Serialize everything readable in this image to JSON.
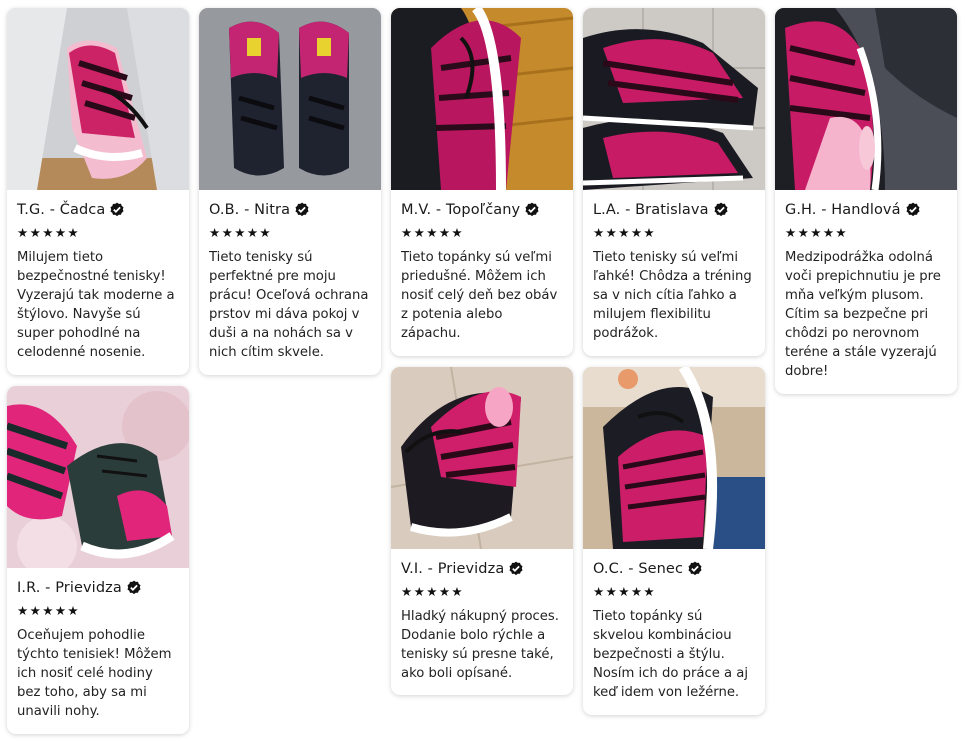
{
  "stars": "★★★★★",
  "reviews": [
    {
      "name": "T.G. - Čadca",
      "lines": [
        "Milujem tieto",
        "bezpečnostné tenisky!",
        "Vyzerajú tak moderne a",
        "štýlovo. Navyše sú",
        "super pohodlné na",
        "celodenné nosenie."
      ]
    },
    {
      "name": "I.R. - Prievidza",
      "lines": [
        "Oceňujem pohodlie",
        "týchto tenisiek! Môžem",
        "ich nosiť celé hodiny",
        "bez toho, aby sa mi",
        "unavili nohy."
      ]
    },
    {
      "name": "O.B. - Nitra",
      "lines": [
        "Tieto tenisky sú",
        "perfektné pre moju",
        "prácu! Oceľová ochrana",
        "prstov mi dáva pokoj v",
        "duši a na nohách sa v",
        "nich cítim skvele."
      ]
    },
    {
      "name": "M.V. - Topoľčany",
      "lines": [
        "Tieto topánky sú veľmi",
        "priedušné. Môžem ich",
        "nosiť celý deň bez obáv",
        "z potenia alebo",
        "zápachu."
      ]
    },
    {
      "name": "V.I. - Prievidza",
      "lines": [
        "Hladký nákupný proces.",
        "Dodanie bolo rýchle a",
        "tenisky sú presne také,",
        "ako boli opísané."
      ]
    },
    {
      "name": "L.A. - Bratislava",
      "lines": [
        "Tieto tenisky sú veľmi",
        "ľahké! Chôdza a tréning",
        "sa v nich cítia ľahko a",
        "milujem flexibilitu",
        "podrážok."
      ]
    },
    {
      "name": "O.C. - Senec",
      "lines": [
        "Tieto topánky sú",
        "skvelou kombináciou",
        "bezpečnosti a štýlu.",
        "Nosím ich do práce a aj",
        "keď idem von ležérne."
      ]
    },
    {
      "name": "G.H. - Handlová",
      "lines": [
        "Medzipodrážka odolná",
        "voči prepichnutiu je pre",
        "mňa veľkým plusom.",
        "Cítim sa bezpečne pri",
        "chôdzi po nerovnom",
        "teréne a stále vyzerajú",
        "dobre!"
      ]
    }
  ]
}
